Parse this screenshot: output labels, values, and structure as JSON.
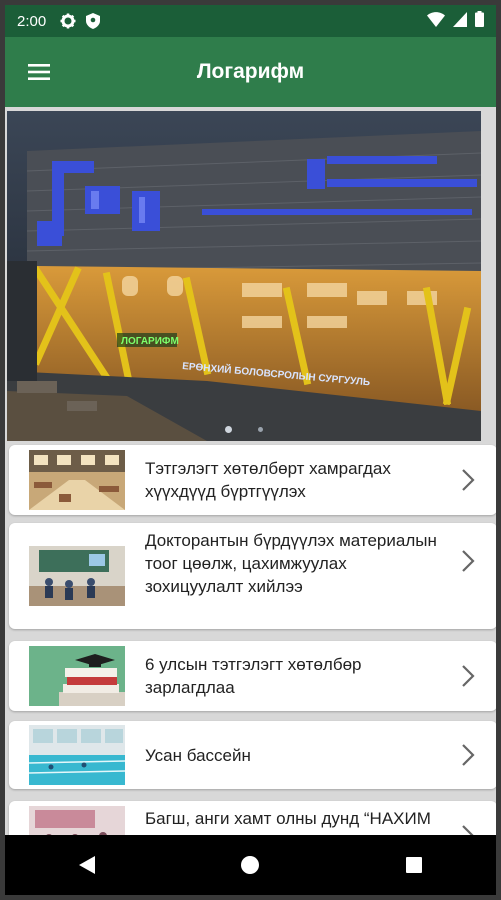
{
  "status_bar": {
    "time": "2:00",
    "icons": [
      "gear-icon",
      "shield-icon",
      "wifi-icon",
      "signal-icon",
      "battery-icon"
    ]
  },
  "app_bar": {
    "title": "Логарифм",
    "menu_icon": "hamburger-menu-icon"
  },
  "banner": {
    "sign_brand": "ЛОГАРИФМ",
    "sign_school": "ЕРӨНХИЙ БОЛОВСРОЛЫН СУРГУУЛЬ",
    "slides_total": 2,
    "active_slide": 1
  },
  "news": [
    {
      "title": "Тэтгэлэгт хөтөлбөрт хамрагдах хүүхдүүд бүртгүүлэх",
      "thumb": "school-hall-photo"
    },
    {
      "title": "Докторантын бүрдүүлэх материалын тоог цөөлж, цахимжуулах зохицуулалт хийлээ",
      "thumb": "classroom-photo"
    },
    {
      "title": "6 улсын тэтгэлэгт хөтөлбөр зарлагдлаа",
      "thumb": "graduation-cap-books-photo"
    },
    {
      "title": "Усан бассейн",
      "thumb": "swimming-pool-photo"
    },
    {
      "title": "Багш, анги хамт олны дунд “НАХИМ АЯЛАЛ”",
      "thumb": "classroom-photo"
    }
  ],
  "colors": {
    "status_bar": "#1b5e38",
    "app_bar": "#2f7d4b",
    "card": "#ffffff",
    "nav_bar": "#000000"
  },
  "nav_bar": [
    "back-icon",
    "home-icon",
    "recents-icon"
  ]
}
